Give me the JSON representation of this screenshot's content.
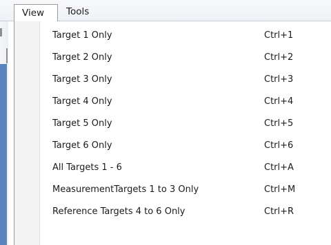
{
  "menubar": {
    "items": [
      {
        "label": "View"
      },
      {
        "label": "Tools"
      }
    ]
  },
  "view_menu": {
    "items": [
      {
        "label": "Target 1 Only",
        "shortcut": "Ctrl+1"
      },
      {
        "label": "Target 2 Only",
        "shortcut": "Ctrl+2"
      },
      {
        "label": "Target 3 Only",
        "shortcut": "Ctrl+3"
      },
      {
        "label": "Target 4 Only",
        "shortcut": "Ctrl+4"
      },
      {
        "label": "Target 5 Only",
        "shortcut": "Ctrl+5"
      },
      {
        "label": "Target 6 Only",
        "shortcut": "Ctrl+6"
      },
      {
        "label": "All Targets 1 - 6",
        "shortcut": "Ctrl+A"
      },
      {
        "label": "MeasurementTargets 1 to 3 Only",
        "shortcut": "Ctrl+M"
      },
      {
        "label": "Reference Targets 4 to 6  Only",
        "shortcut": "Ctrl+R"
      }
    ]
  }
}
